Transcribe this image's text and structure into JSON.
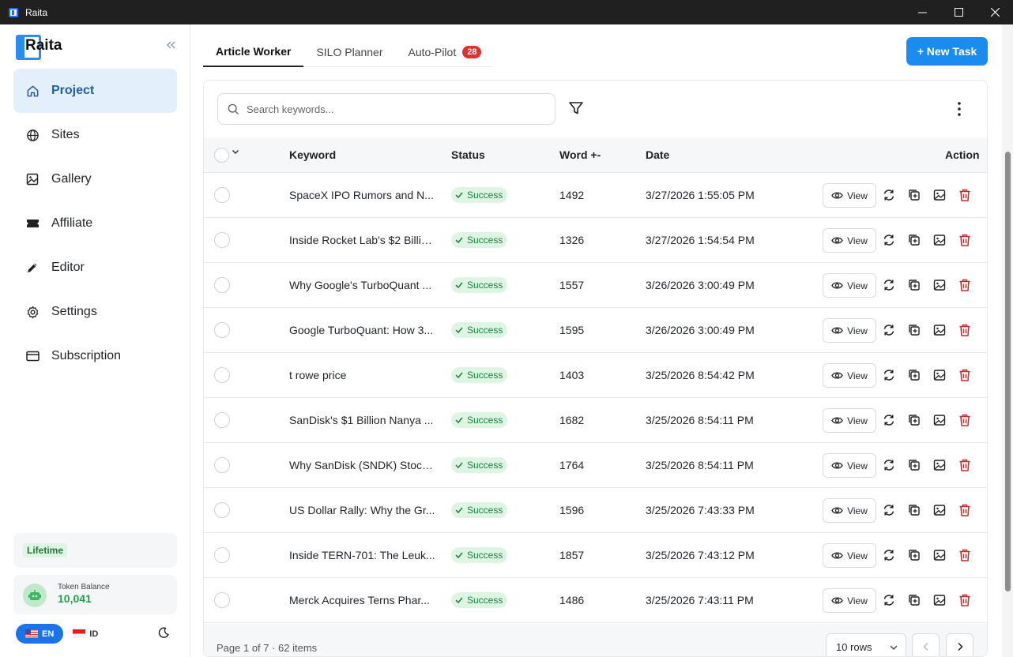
{
  "window": {
    "title": "Raita"
  },
  "sidebar": {
    "brand": "Raita",
    "items": [
      {
        "label": "Project",
        "icon": "home-icon",
        "active": true
      },
      {
        "label": "Sites",
        "icon": "globe-icon",
        "active": false
      },
      {
        "label": "Gallery",
        "icon": "image-icon",
        "active": false
      },
      {
        "label": "Affiliate",
        "icon": "ticket-icon",
        "active": false
      },
      {
        "label": "Editor",
        "icon": "pencil-icon",
        "active": false
      },
      {
        "label": "Settings",
        "icon": "gear-icon",
        "active": false
      },
      {
        "label": "Subscription",
        "icon": "card-icon",
        "active": false
      }
    ],
    "plan": "Lifetime",
    "token": {
      "label": "Token Balance",
      "value": "10,041"
    },
    "lang": {
      "en": "EN",
      "id": "ID"
    }
  },
  "tabs": [
    {
      "label": "Article Worker",
      "active": true
    },
    {
      "label": "SILO Planner",
      "active": false
    },
    {
      "label": "Auto-Pilot",
      "active": false,
      "badge": "28"
    }
  ],
  "new_task_label": "+ New Task",
  "search": {
    "placeholder": "Search keywords..."
  },
  "table": {
    "headers": {
      "keyword": "Keyword",
      "status": "Status",
      "word": "Word +-",
      "date": "Date",
      "action": "Action"
    },
    "view_label": "View",
    "rows": [
      {
        "keyword": "SpaceX IPO Rumors and N...",
        "status": "Success",
        "words": "1492",
        "date": "3/27/2026 1:55:05 PM"
      },
      {
        "keyword": "Inside Rocket Lab's $2 Billio...",
        "status": "Success",
        "words": "1326",
        "date": "3/27/2026 1:54:54 PM"
      },
      {
        "keyword": "Why Google's TurboQuant ...",
        "status": "Success",
        "words": "1557",
        "date": "3/26/2026 3:00:49 PM"
      },
      {
        "keyword": "Google TurboQuant: How 3...",
        "status": "Success",
        "words": "1595",
        "date": "3/26/2026 3:00:49 PM"
      },
      {
        "keyword": "t rowe price",
        "status": "Success",
        "words": "1403",
        "date": "3/25/2026 8:54:42 PM"
      },
      {
        "keyword": "SanDisk's $1 Billion Nanya ...",
        "status": "Success",
        "words": "1682",
        "date": "3/25/2026 8:54:11 PM"
      },
      {
        "keyword": "Why SanDisk (SNDK) Stock ...",
        "status": "Success",
        "words": "1764",
        "date": "3/25/2026 8:54:11 PM"
      },
      {
        "keyword": "US Dollar Rally: Why the Gr...",
        "status": "Success",
        "words": "1596",
        "date": "3/25/2026 7:43:33 PM"
      },
      {
        "keyword": "Inside TERN-701: The Leuk...",
        "status": "Success",
        "words": "1857",
        "date": "3/25/2026 7:43:12 PM"
      },
      {
        "keyword": "Merck Acquires Terns Phar...",
        "status": "Success",
        "words": "1486",
        "date": "3/25/2026 7:43:11 PM"
      }
    ]
  },
  "footer": {
    "page_info": "Page 1 of 7 · 62 items",
    "rows_label": "10 rows"
  },
  "colors": {
    "accent": "#1a8cf0",
    "success_bg": "#def5e3",
    "success_text": "#1a7f3c",
    "danger": "#c92a2a",
    "badge": "#e03131"
  }
}
